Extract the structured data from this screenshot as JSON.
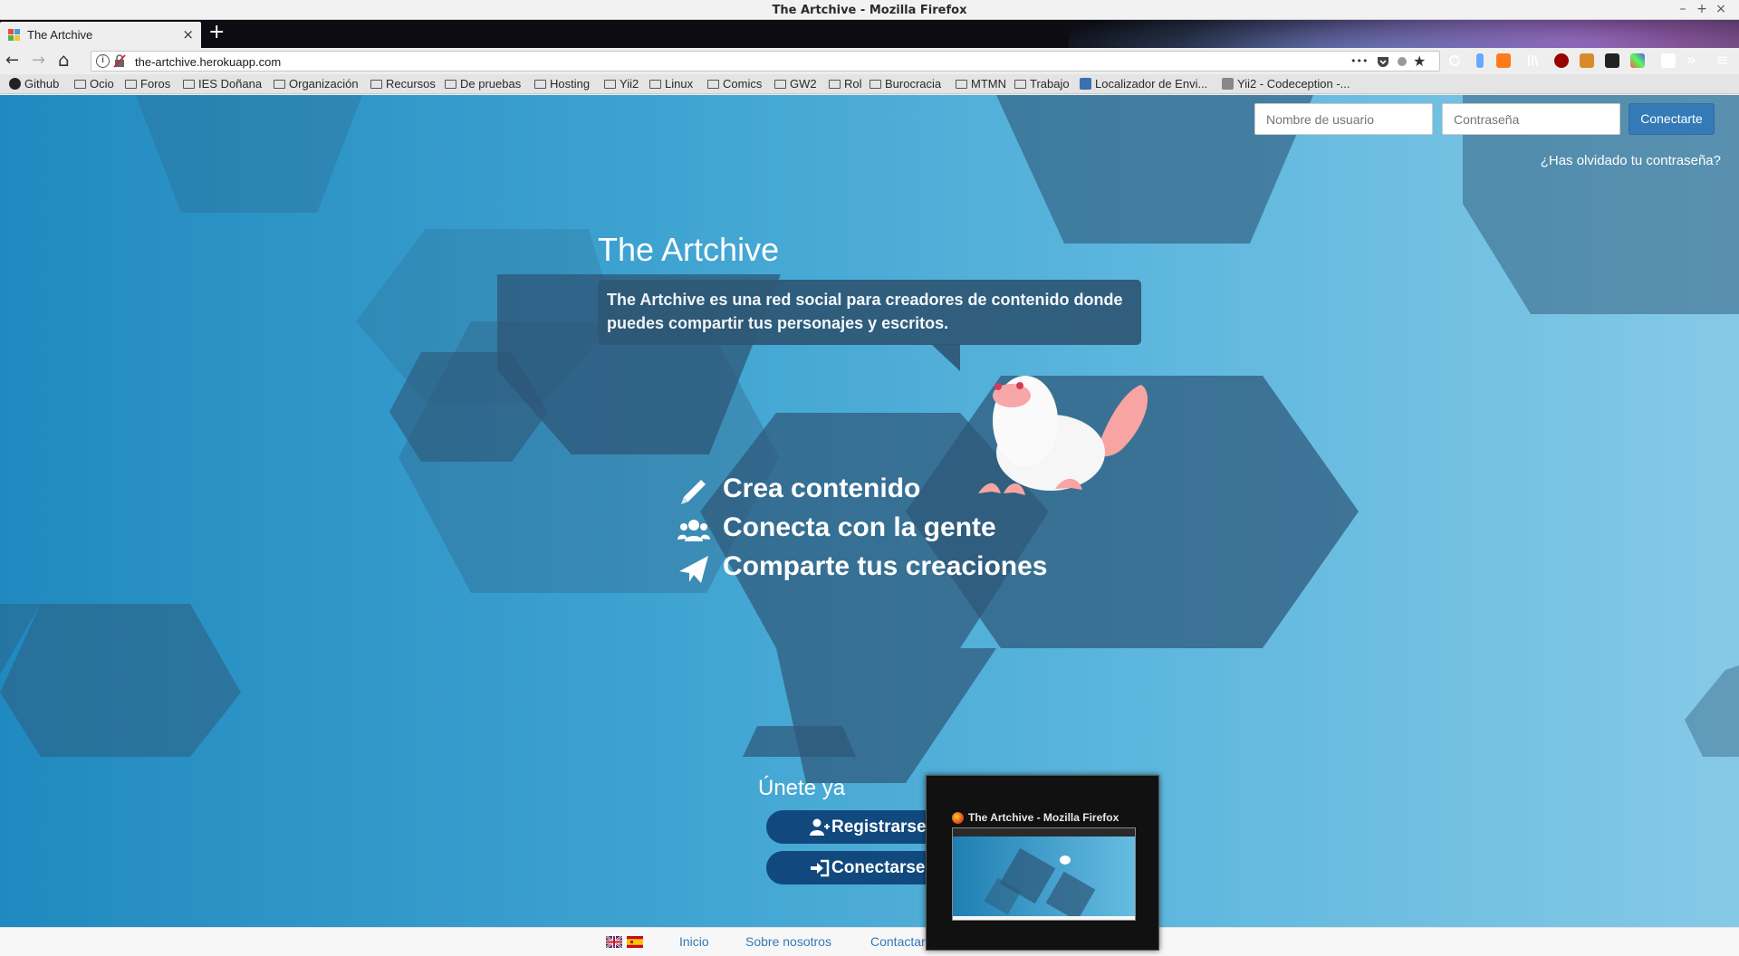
{
  "window": {
    "title": "The Artchive - Mozilla Firefox",
    "controls": [
      "–",
      "+",
      "×"
    ]
  },
  "tabs": [
    {
      "label": "The Artchive",
      "active": true,
      "close": "×"
    }
  ],
  "new_tab_label": "+",
  "navbar": {
    "back": "←",
    "forward": "→",
    "home": "⌂",
    "url": "the-artchive.herokuapp.com",
    "page_actions": [
      "•••",
      "★"
    ],
    "toolbar_icons": [
      "reload-icon",
      "library-icon",
      "ublock-icon",
      "extension-icon",
      "overflow-icon",
      "menu-icon"
    ],
    "overflow": "»",
    "menu": "≡"
  },
  "bookmarks": [
    {
      "label": "Github",
      "icon": "github-icon"
    },
    {
      "label": "Ocio",
      "icon": "folder-icon"
    },
    {
      "label": "Foros",
      "icon": "folder-icon"
    },
    {
      "label": "IES Doñana",
      "icon": "folder-icon"
    },
    {
      "label": "Organización",
      "icon": "folder-icon"
    },
    {
      "label": "Recursos",
      "icon": "folder-icon"
    },
    {
      "label": "De pruebas",
      "icon": "folder-icon"
    },
    {
      "label": "Hosting",
      "icon": "folder-icon"
    },
    {
      "label": "Yii2",
      "icon": "folder-icon"
    },
    {
      "label": "Linux",
      "icon": "folder-icon"
    },
    {
      "label": "Comics",
      "icon": "folder-icon"
    },
    {
      "label": "GW2",
      "icon": "folder-icon"
    },
    {
      "label": "Rol",
      "icon": "folder-icon"
    },
    {
      "label": "Burocracia",
      "icon": "folder-icon"
    },
    {
      "label": "MTMN",
      "icon": "folder-icon"
    },
    {
      "label": "Trabajo",
      "icon": "folder-icon"
    },
    {
      "label": "Localizador de Envi...",
      "icon": "location-icon"
    },
    {
      "label": "Yii2 - Codeception -...",
      "icon": "page-icon"
    }
  ],
  "login": {
    "username_placeholder": "Nombre de usuario",
    "password_placeholder": "Contraseña",
    "submit": "Conectarte",
    "forgot": "¿Has olvidado tu contraseña?"
  },
  "hero": {
    "title": "The Artchive",
    "description": "The Artchive es una red social para creadores de contenido donde puedes compartir tus personajes y escritos."
  },
  "features": [
    {
      "label": "Crea contenido",
      "icon": "pencil-icon"
    },
    {
      "label": "Conecta con la gente",
      "icon": "users-icon"
    },
    {
      "label": "Comparte tus creaciones",
      "icon": "paper-plane-icon"
    }
  ],
  "join": {
    "title": "Únete ya",
    "register": "Registrarse",
    "connect": "Conectarse"
  },
  "footer": {
    "languages": [
      "english-flag-icon",
      "spanish-flag-icon"
    ],
    "links": [
      "Inicio",
      "Sobre nosotros",
      "Contactar"
    ]
  },
  "taskbar_preview": {
    "title": "The Artchive - Mozilla Firefox"
  },
  "colors": {
    "page_gradient_start": "#2089bf",
    "page_gradient_end": "#86c9e7",
    "hexagon": "#2d5778",
    "primary_button": "#337ab7",
    "cta_button": "#11497e",
    "footer_link": "#337ab7"
  }
}
